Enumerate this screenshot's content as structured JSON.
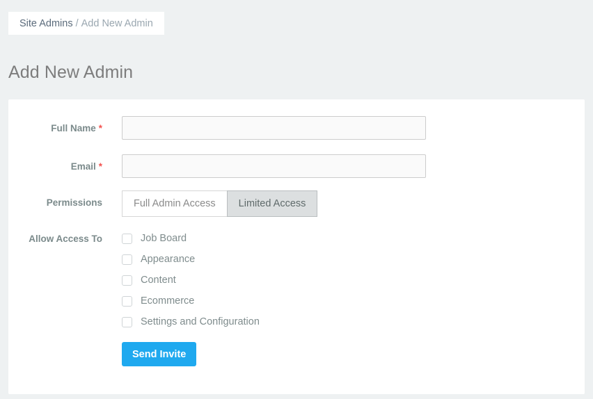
{
  "breadcrumb": {
    "root": "Site Admins",
    "separator": "/",
    "current": "Add New Admin"
  },
  "page": {
    "title": "Add New Admin"
  },
  "form": {
    "full_name": {
      "label": "Full Name",
      "required_marker": "*",
      "value": "",
      "placeholder": ""
    },
    "email": {
      "label": "Email",
      "required_marker": "*",
      "value": "",
      "placeholder": ""
    },
    "permissions": {
      "label": "Permissions",
      "options": [
        {
          "label": "Full Admin Access",
          "selected": false
        },
        {
          "label": "Limited Access",
          "selected": true
        }
      ]
    },
    "allow_access_to": {
      "label": "Allow Access To",
      "items": [
        {
          "label": "Job Board",
          "checked": false
        },
        {
          "label": "Appearance",
          "checked": false
        },
        {
          "label": "Content",
          "checked": false
        },
        {
          "label": "Ecommerce",
          "checked": false
        },
        {
          "label": "Settings and Configuration",
          "checked": false
        }
      ]
    },
    "submit": {
      "label": "Send Invite"
    }
  },
  "colors": {
    "page_background": "#eef1f2",
    "card_background": "#ffffff",
    "accent_blue": "#1fa9ef",
    "required_red": "#f3524f",
    "label_gray": "#7b8a8b",
    "segment_active_bg": "#dcdfe0"
  }
}
